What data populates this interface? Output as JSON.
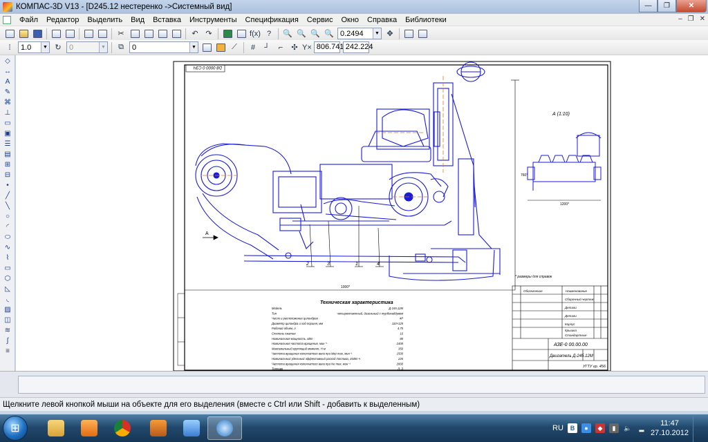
{
  "window": {
    "title": "КОМПАС-3D V13 - [D245.12 нестеренко ->Системный вид]",
    "btn_minimize": "—",
    "btn_maximize": "❐",
    "btn_close": "✕"
  },
  "menu": {
    "items": [
      "Файл",
      "Редактор",
      "Выделить",
      "Вид",
      "Вставка",
      "Инструменты",
      "Спецификация",
      "Сервис",
      "Окно",
      "Справка",
      "Библиотеки"
    ],
    "doc_controls": [
      "–",
      "❐",
      "✕"
    ]
  },
  "toolbar1": {
    "zoom_value": "0.2494"
  },
  "toolbar2": {
    "line_scale": "1.0",
    "step_value": "0",
    "layer_value": "0",
    "coord_x": "806.741",
    "coord_y": "242.224",
    "coord_label": "Y×"
  },
  "drawing": {
    "stamp_top": "D8 0000 0 CЗЧ",
    "view_label": "А (1:10)",
    "arrow_label": "А",
    "dim_width": "1000*",
    "dim_side": "1200*",
    "dim_height": "760*",
    "callouts": [
      "2",
      "3",
      "1",
      "4"
    ],
    "note": "* размеры для справок",
    "spec_title": "Техническая характеристика",
    "spec_rows": [
      [
        "Модель",
        "Д-245.12М"
      ],
      [
        "Тип",
        "четырехтактный, дизельный с турбонаддувом"
      ],
      [
        "Число и расположение цилиндров",
        "4Р"
      ],
      [
        "Диаметр цилиндра и ход поршня, мм",
        "110×125"
      ],
      [
        "Рабочий объем, л",
        "4,75"
      ],
      [
        "Степень сжатия",
        "16"
      ],
      [
        "Номинальная мощность, кВт",
        "80"
      ],
      [
        "Номинальная частота вращения, мин⁻¹",
        "2400"
      ],
      [
        "Максимальный крутящий момент, Н·м",
        "350"
      ],
      [
        "Частота вращения коленчатого вала при Мкр max, мин⁻¹",
        "1500"
      ],
      [
        "Номинальный удельный эффективный расход топлива, г/кВт·ч",
        "226"
      ],
      [
        "Частота вращения коленчатого вала при Ne max, мин⁻¹",
        "2800"
      ],
      [
        "Топливо",
        "Л; З"
      ]
    ],
    "title_block": {
      "designation": "АЗЕ-0 00.00.00",
      "name": "Двигатель Д-245.12М",
      "org": "УГТУ гр. 456",
      "col_headers": [
        "Обозначение",
        "Наименование"
      ],
      "item_rows": [
        "Сборочный чертеж",
        "Детали",
        "Детали",
        "Корпус",
        "Крышка",
        "Стандартные"
      ]
    }
  },
  "status": {
    "message": "Щелкните левой кнопкой мыши на объекте для его выделения (вместе с Ctrl или Shift - добавить к выделенным)"
  },
  "taskbar": {
    "lang": "RU",
    "time": "11:47",
    "date": "27.10.2012"
  },
  "colors": {
    "drawing_blue": "#1a1ad8",
    "axis_orange": "#d77a18",
    "frame_black": "#000000"
  }
}
